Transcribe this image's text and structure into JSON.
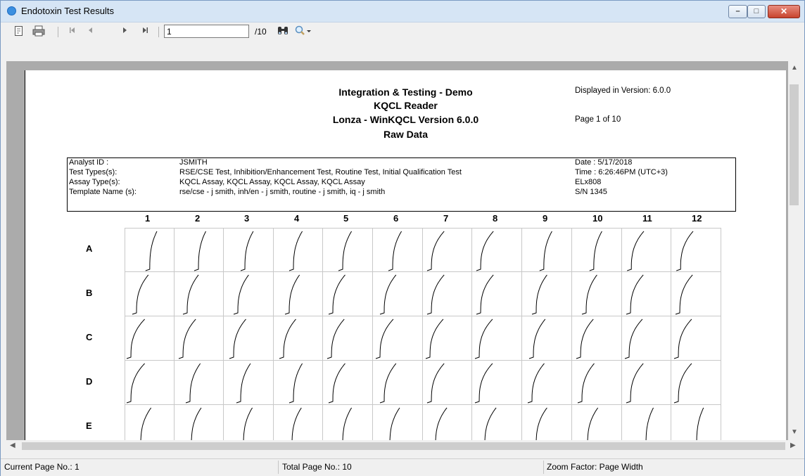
{
  "window": {
    "title": "Endotoxin Test Results"
  },
  "toolbar": {
    "icons": [
      "export-icon",
      "print-icon",
      "first-page-icon",
      "prev-page-icon",
      "next-page-icon",
      "last-page-icon",
      "find-icon",
      "zoom-icon"
    ],
    "page_value": "1",
    "page_total": "/10"
  },
  "report": {
    "header_lines": [
      "Integration & Testing - Demo",
      "KQCL Reader",
      "Lonza - WinKQCL Version 6.0.0",
      "Raw Data"
    ],
    "displayed_version": "Displayed in Version: 6.0.0",
    "page_of": "Page 1 of 10",
    "info_labels": [
      "Analyst ID :",
      "Test Types(s):",
      "Assay Type(s):",
      "Template Name (s):"
    ],
    "info_values": [
      "JSMITH",
      "RSE/CSE Test, Inhibition/Enhancement Test, Routine Test, Initial Qualification Test",
      "KQCL Assay, KQCL Assay, KQCL Assay, KQCL Assay",
      "rse/cse - j smith, inh/en - j smith, routine - j smith, iq - j smith"
    ],
    "info_right": [
      "Date : 5/17/2018",
      "Time :  6:26:46PM (UTC+3)",
      "ELx808",
      "S/N 1345"
    ],
    "columns": [
      "1",
      "2",
      "3",
      "4",
      "5",
      "6",
      "7",
      "8",
      "9",
      "10",
      "11",
      "12"
    ],
    "rows": [
      "A",
      "B",
      "C",
      "D",
      "E"
    ]
  },
  "statusbar": {
    "current_page": "Current Page No.: 1",
    "total_pages": "Total Page No.: 10",
    "zoom": "Zoom Factor: Page Width"
  }
}
